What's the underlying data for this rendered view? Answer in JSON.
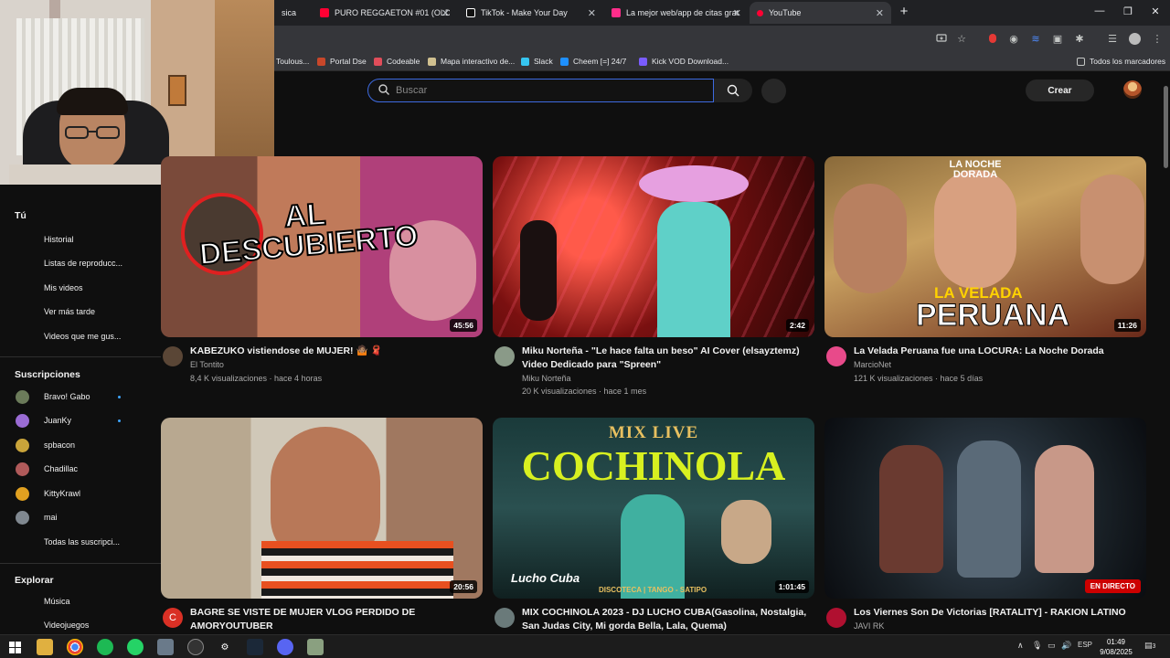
{
  "browser": {
    "tabs": [
      {
        "label": "sica",
        "color": "#ff0033"
      },
      {
        "label": "PURO REGGAETON #01 (OLD)",
        "color": "#ff0033"
      },
      {
        "label": "TikTok - Make Your Day",
        "color": "#ffffff"
      },
      {
        "label": "La mejor web/app de citas grat",
        "color": "#ff2d8a"
      },
      {
        "label": "YouTube",
        "color": "#ff0033"
      }
    ],
    "new_tab": "+",
    "bookmarks": [
      {
        "label": "Toulous...",
        "color": "#3a3a3a"
      },
      {
        "label": "Portal Dse",
        "color": "#c8472a"
      },
      {
        "label": "Codeable",
        "color": "#e04d5a"
      },
      {
        "label": "Mapa interactivo de...",
        "color": "#d0c090"
      },
      {
        "label": "Slack",
        "color": "#36c5f0"
      },
      {
        "label": "Cheem [=] 24/7",
        "color": "#1e90ff"
      },
      {
        "label": "Kick VOD Download...",
        "color": "#7a5cff"
      }
    ],
    "all_bookmarks": "Todos los marcadores"
  },
  "youtube": {
    "search_placeholder": "Buscar",
    "create_label": "Crear"
  },
  "sidebar": {
    "you_title": "Tú",
    "you_items": [
      {
        "label": "Historial"
      },
      {
        "label": "Listas de reproducc..."
      },
      {
        "label": "Mis videos"
      },
      {
        "label": "Ver más tarde"
      },
      {
        "label": "Videos que me gus..."
      }
    ],
    "subs_title": "Suscripciones",
    "subs_items": [
      {
        "label": "Bravo! Gabo",
        "color": "#6b7b5a",
        "new": true
      },
      {
        "label": "JuanKy",
        "color": "#9a6cd4",
        "new": true
      },
      {
        "label": "spbacon",
        "color": "#c9a43a",
        "new": false
      },
      {
        "label": "Chadillac",
        "color": "#b05a5a",
        "new": false
      },
      {
        "label": "KittyKrawl",
        "color": "#e0a020",
        "new": false
      },
      {
        "label": "mai",
        "color": "#808890",
        "new": false
      }
    ],
    "all_subs": "Todas las suscripci...",
    "explore_title": "Explorar",
    "explore_items": [
      {
        "label": "Música"
      },
      {
        "label": "Videojuegos"
      }
    ]
  },
  "videos": [
    {
      "title": "KABEZUKO vistiendose de MUJER! 🤷🏽 🧣",
      "channel": "El Tontito",
      "meta": "8,4 K visualizaciones · hace 4 horas",
      "duration": "45:56",
      "overlay": [
        "AL",
        "DESCUBIERTO"
      ],
      "avatar_color": "#5a4636"
    },
    {
      "title": "Miku Norteña - \"Le hace falta un beso\" AI Cover (elsayztemz) Video Dedicado para \"Spreen\"",
      "channel": "Miku Norteña",
      "meta": "20 K visualizaciones · hace 1 mes",
      "duration": "2:42",
      "overlay": [],
      "avatar_color": "#8a9a88"
    },
    {
      "title": "La Velada Peruana fue una LOCURA: La Noche Dorada",
      "channel": "MarcioNet",
      "meta": "121 K visualizaciones · hace 5 días",
      "duration": "11:26",
      "overlay": [
        "LA NOCHE",
        "DORADA",
        "LA VELADA",
        "PERUANA"
      ],
      "avatar_color": "#e84a8a"
    },
    {
      "title": "BAGRE SE VISTE DE MUJER VLOG PERDIDO DE AMORYOUTUBER",
      "channel": "",
      "meta": "",
      "duration": "20:56",
      "overlay": [],
      "avatar_color": "#d93025",
      "avatar_letter": "C"
    },
    {
      "title": "MIX COCHINOLA 2023 - DJ LUCHO CUBA(Gasolina, Nostalgia, San Judas City, Mi gorda Bella, Lala, Quema)",
      "channel": "",
      "meta": "",
      "duration": "1:01:45",
      "overlay": [
        "MIX LIVE",
        "COCHINOLA",
        "DISCOTECA | TANGO - SATIPO",
        "Lucho Cuba"
      ],
      "avatar_color": "#6a7a7a"
    },
    {
      "title": "Los Viernes Son De Victorias [RATALITY] - RAKION LATINO",
      "channel": "JAVI RK",
      "meta": "",
      "duration": "",
      "live": "EN DIRECTO",
      "overlay": [],
      "avatar_color": "#b01030"
    }
  ],
  "taskbar": {
    "lang": "ESP",
    "time": "01:49",
    "date": "9/08/2025",
    "notifications": "3"
  }
}
